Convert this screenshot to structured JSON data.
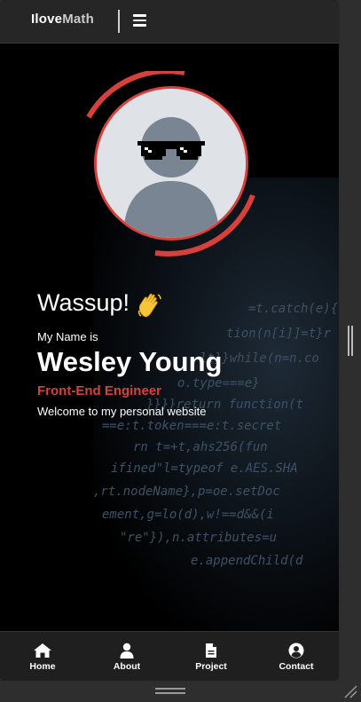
{
  "header": {
    "logo_bold": "Ilove",
    "logo_rest": "Math",
    "menu_icon": "hamburger-icon"
  },
  "hero": {
    "greeting": "Wassup!",
    "wave_icon": "waving-hand-icon",
    "intro": "My Name is",
    "name": "Wesley Young",
    "role": "Front-End Engineer",
    "welcome": "Welcome to my personal website",
    "accent_color": "#d8403c"
  },
  "background_code": [
    "=t.catch(e){re",
    "tion(n[i]]=t}r",
    "lt}}while(n=n.co",
    "o.type===e}",
    "}}}}return function(t",
    "==e:t.token===e:t.secret",
    "rn t=+t,ahs256(fun",
    "ifined\"l=typeof e.AES.SHA",
    ",rt.nodeName},p=oe.setDoc",
    "ement,g=lo(d),w!==d&&(i",
    "\"re\"}),n.attributes=u",
    "e.appendChild(d"
  ],
  "nav": {
    "items": [
      {
        "label": "Home",
        "icon": "home-icon"
      },
      {
        "label": "About",
        "icon": "user-icon"
      },
      {
        "label": "Project",
        "icon": "document-icon"
      },
      {
        "label": "Contact",
        "icon": "account-circle-icon"
      }
    ]
  }
}
